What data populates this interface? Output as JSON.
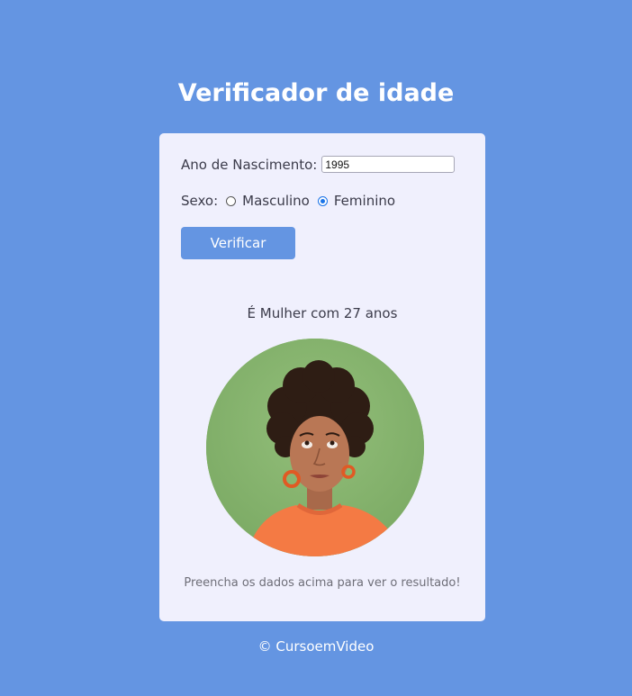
{
  "header": {
    "title": "Verificador de idade"
  },
  "form": {
    "year_label": "Ano de Nascimento:",
    "year_value": "1995",
    "sex_label": "Sexo:",
    "sex_options": [
      {
        "label": "Masculino",
        "checked": false
      },
      {
        "label": "Feminino",
        "checked": true
      }
    ],
    "verify_label": "Verificar"
  },
  "result": {
    "text": "É Mulher com 27 anos",
    "photo_icon": "woman-photo",
    "hint": "Preencha os dados acima para ver o resultado!"
  },
  "footer": {
    "text": "© CursoemVideo"
  },
  "colors": {
    "background": "#6495e2",
    "card": "#f0f0fd",
    "button": "#6495e2",
    "radio_selected": "#1a73e8"
  }
}
